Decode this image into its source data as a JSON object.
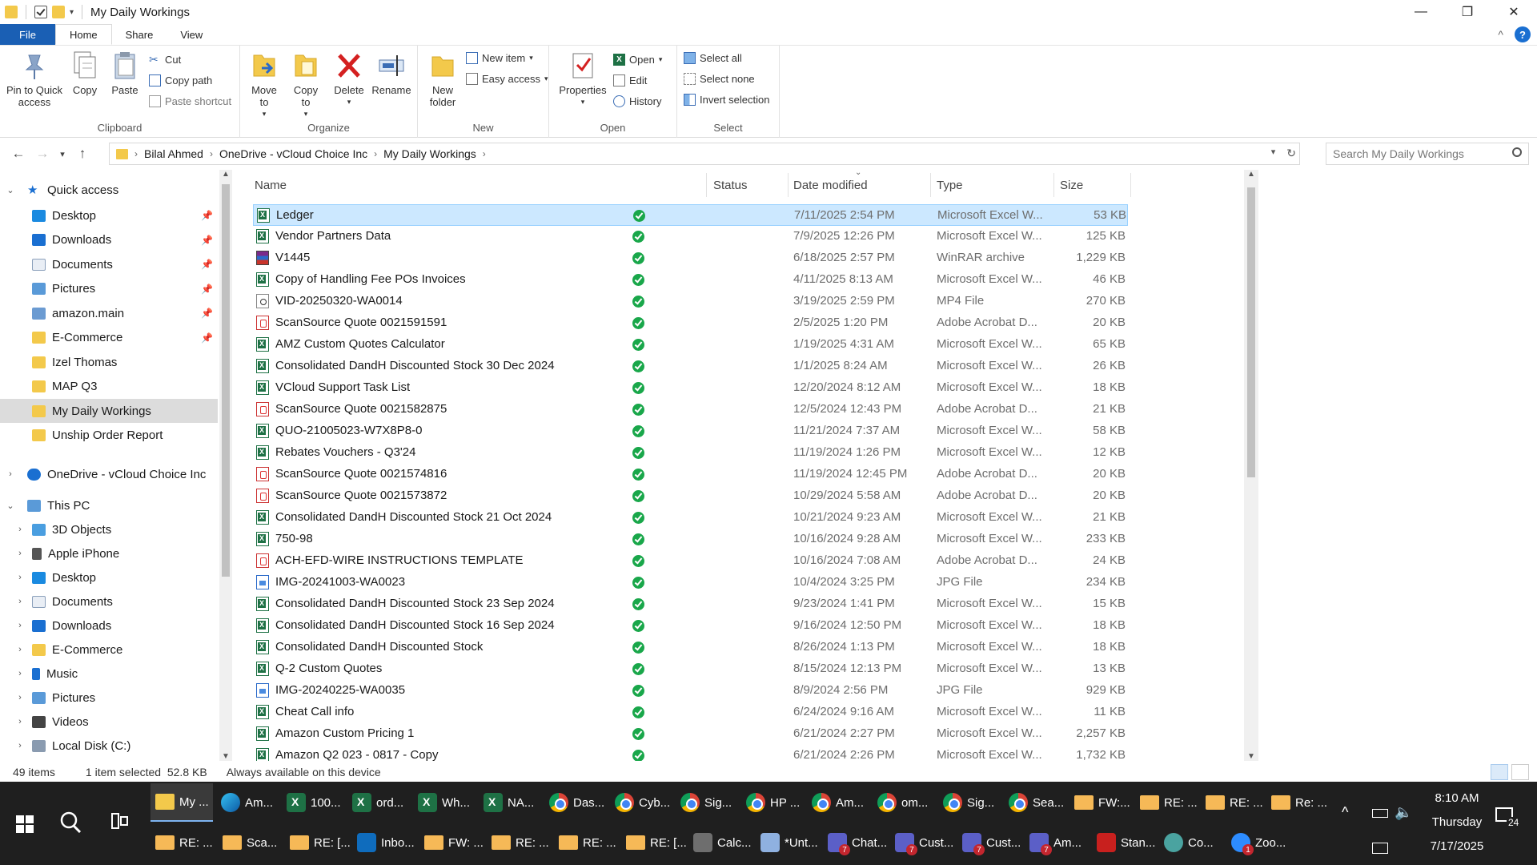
{
  "window": {
    "title": "My Daily Workings",
    "minimize": "—",
    "maximize": "❐",
    "close": "✕"
  },
  "tabs": {
    "file": "File",
    "home": "Home",
    "share": "Share",
    "view": "View",
    "collapse": "^",
    "help": "?"
  },
  "ribbon": {
    "clipboard": {
      "label": "Clipboard",
      "pin": "Pin to Quick access",
      "copy": "Copy",
      "paste": "Paste",
      "cut": "Cut",
      "copy_path": "Copy path",
      "paste_shortcut": "Paste shortcut"
    },
    "organize": {
      "label": "Organize",
      "move_to": "Move to",
      "copy_to": "Copy to",
      "delete": "Delete",
      "rename": "Rename"
    },
    "new": {
      "label": "New",
      "new_folder": "New folder",
      "new_item": "New item",
      "easy_access": "Easy access"
    },
    "open": {
      "label": "Open",
      "properties": "Properties",
      "open": "Open",
      "edit": "Edit",
      "history": "History"
    },
    "select": {
      "label": "Select",
      "select_all": "Select all",
      "select_none": "Select none",
      "invert": "Invert selection"
    }
  },
  "address": {
    "crumbs": [
      "Bilal Ahmed",
      "OneDrive - vCloud Choice Inc",
      "My Daily Workings"
    ],
    "search_placeholder": "Search My Daily Workings"
  },
  "nav": {
    "quick_access": "Quick access",
    "quick_items": [
      "Desktop",
      "Downloads",
      "Documents",
      "Pictures",
      "amazon.main",
      "E-Commerce",
      "Izel Thomas",
      "MAP Q3",
      "My Daily Workings",
      "Unship Order Report"
    ],
    "onedrive": "OneDrive - vCloud Choice Inc",
    "this_pc": "This PC",
    "pc_items": [
      "3D Objects",
      "Apple iPhone",
      "Desktop",
      "Documents",
      "Downloads",
      "E-Commerce",
      "Music",
      "Pictures",
      "Videos",
      "Local Disk (C:)"
    ]
  },
  "columns": {
    "name": "Name",
    "status": "Status",
    "date": "Date modified",
    "type": "Type",
    "size": "Size"
  },
  "files": [
    {
      "name": "Ledger",
      "date": "7/11/2025 2:54 PM",
      "type": "Microsoft Excel W...",
      "size": "53 KB",
      "icon": "excel"
    },
    {
      "name": "Vendor Partners Data",
      "date": "7/9/2025 12:26 PM",
      "type": "Microsoft Excel W...",
      "size": "125 KB",
      "icon": "excel"
    },
    {
      "name": "V1445",
      "date": "6/18/2025 2:57 PM",
      "type": "WinRAR archive",
      "size": "1,229 KB",
      "icon": "rar"
    },
    {
      "name": "Copy of Handling Fee POs Invoices",
      "date": "4/11/2025 8:13 AM",
      "type": "Microsoft Excel W...",
      "size": "46 KB",
      "icon": "excel"
    },
    {
      "name": "VID-20250320-WA0014",
      "date": "3/19/2025 2:59 PM",
      "type": "MP4 File",
      "size": "270 KB",
      "icon": "mp4"
    },
    {
      "name": "ScanSource Quote 0021591591",
      "date": "2/5/2025 1:20 PM",
      "type": "Adobe Acrobat D...",
      "size": "20 KB",
      "icon": "pdf"
    },
    {
      "name": "AMZ Custom Quotes Calculator",
      "date": "1/19/2025 4:31 AM",
      "type": "Microsoft Excel W...",
      "size": "65 KB",
      "icon": "excel"
    },
    {
      "name": "Consolidated DandH Discounted Stock 30 Dec 2024",
      "date": "1/1/2025 8:24 AM",
      "type": "Microsoft Excel W...",
      "size": "26 KB",
      "icon": "excel"
    },
    {
      "name": "VCloud Support Task List",
      "date": "12/20/2024 8:12 AM",
      "type": "Microsoft Excel W...",
      "size": "18 KB",
      "icon": "excel"
    },
    {
      "name": "ScanSource Quote 0021582875",
      "date": "12/5/2024 12:43 PM",
      "type": "Adobe Acrobat D...",
      "size": "21 KB",
      "icon": "pdf"
    },
    {
      "name": "QUO-21005023-W7X8P8-0",
      "date": "11/21/2024 7:37 AM",
      "type": "Microsoft Excel W...",
      "size": "58 KB",
      "icon": "excel"
    },
    {
      "name": "Rebates Vouchers - Q3'24",
      "date": "11/19/2024 1:26 PM",
      "type": "Microsoft Excel W...",
      "size": "12 KB",
      "icon": "excel"
    },
    {
      "name": "ScanSource Quote 0021574816",
      "date": "11/19/2024 12:45 PM",
      "type": "Adobe Acrobat D...",
      "size": "20 KB",
      "icon": "pdf"
    },
    {
      "name": "ScanSource Quote 0021573872",
      "date": "10/29/2024 5:58 AM",
      "type": "Adobe Acrobat D...",
      "size": "20 KB",
      "icon": "pdf"
    },
    {
      "name": "Consolidated DandH Discounted Stock 21 Oct 2024",
      "date": "10/21/2024 9:23 AM",
      "type": "Microsoft Excel W...",
      "size": "21 KB",
      "icon": "excel"
    },
    {
      "name": "750-98",
      "date": "10/16/2024 9:28 AM",
      "type": "Microsoft Excel W...",
      "size": "233 KB",
      "icon": "excel"
    },
    {
      "name": "ACH-EFD-WIRE INSTRUCTIONS TEMPLATE",
      "date": "10/16/2024 7:08 AM",
      "type": "Adobe Acrobat D...",
      "size": "24 KB",
      "icon": "pdf"
    },
    {
      "name": "IMG-20241003-WA0023",
      "date": "10/4/2024 3:25 PM",
      "type": "JPG File",
      "size": "234 KB",
      "icon": "jpg"
    },
    {
      "name": "Consolidated DandH Discounted Stock 23 Sep 2024",
      "date": "9/23/2024 1:41 PM",
      "type": "Microsoft Excel W...",
      "size": "15 KB",
      "icon": "excel"
    },
    {
      "name": "Consolidated DandH Discounted Stock 16 Sep 2024",
      "date": "9/16/2024 12:50 PM",
      "type": "Microsoft Excel W...",
      "size": "18 KB",
      "icon": "excel"
    },
    {
      "name": "Consolidated DandH Discounted Stock",
      "date": "8/26/2024 1:13 PM",
      "type": "Microsoft Excel W...",
      "size": "18 KB",
      "icon": "excel"
    },
    {
      "name": "Q-2 Custom Quotes",
      "date": "8/15/2024 12:13 PM",
      "type": "Microsoft Excel W...",
      "size": "13 KB",
      "icon": "excel"
    },
    {
      "name": "IMG-20240225-WA0035",
      "date": "8/9/2024 2:56 PM",
      "type": "JPG File",
      "size": "929 KB",
      "icon": "jpg"
    },
    {
      "name": "Cheat Call info",
      "date": "6/24/2024 9:16 AM",
      "type": "Microsoft Excel W...",
      "size": "11 KB",
      "icon": "excel"
    },
    {
      "name": "Amazon Custom Pricing 1",
      "date": "6/21/2024 2:27 PM",
      "type": "Microsoft Excel W...",
      "size": "2,257 KB",
      "icon": "excel"
    },
    {
      "name": "Amazon Q2 023 - 0817 - Copy",
      "date": "6/21/2024 2:26 PM",
      "type": "Microsoft Excel W...",
      "size": "1,732 KB",
      "icon": "excel"
    }
  ],
  "statusbar": {
    "count": "49 items",
    "selected": "1 item selected  52.8 KB",
    "availability": "Always available on this device"
  },
  "taskbar": {
    "row1": [
      {
        "label": "My ...",
        "icon": "folder",
        "active": true
      },
      {
        "label": "Am...",
        "icon": "edge"
      },
      {
        "label": "100...",
        "icon": "excel"
      },
      {
        "label": "ord...",
        "icon": "excel"
      },
      {
        "label": "Wh...",
        "icon": "excel"
      },
      {
        "label": "NA...",
        "icon": "excel"
      },
      {
        "label": "Das...",
        "icon": "chrome"
      },
      {
        "label": "Cyb...",
        "icon": "chrome"
      },
      {
        "label": "Sig...",
        "icon": "chrome"
      },
      {
        "label": "HP ...",
        "icon": "chrome"
      },
      {
        "label": "Am...",
        "icon": "chrome"
      },
      {
        "label": "om...",
        "icon": "chrome"
      },
      {
        "label": "Sig...",
        "icon": "chrome"
      },
      {
        "label": "Sea...",
        "icon": "chrome"
      },
      {
        "label": "FW:...",
        "icon": "mail"
      },
      {
        "label": "RE: ...",
        "icon": "mail"
      },
      {
        "label": "RE: ...",
        "icon": "mail"
      },
      {
        "label": "Re: ...",
        "icon": "mail"
      }
    ],
    "row2": [
      {
        "label": "RE: ...",
        "icon": "mail"
      },
      {
        "label": "Sca...",
        "icon": "mail"
      },
      {
        "label": "RE: [...",
        "icon": "mail"
      },
      {
        "label": "Inbo...",
        "icon": "outlook"
      },
      {
        "label": "FW: ...",
        "icon": "mail"
      },
      {
        "label": "RE: ...",
        "icon": "mail"
      },
      {
        "label": "RE: ...",
        "icon": "mail"
      },
      {
        "label": "RE: [...",
        "icon": "mail"
      },
      {
        "label": "Calc...",
        "icon": "calc"
      },
      {
        "label": "*Unt...",
        "icon": "note"
      },
      {
        "label": "Chat...",
        "icon": "teams",
        "badge": "7"
      },
      {
        "label": "Cust...",
        "icon": "teams",
        "badge": "7"
      },
      {
        "label": "Cust...",
        "icon": "teams",
        "badge": "7"
      },
      {
        "label": "Am...",
        "icon": "teams",
        "badge": "7"
      },
      {
        "label": "Stan...",
        "icon": "pdf"
      },
      {
        "label": "Co...",
        "icon": "co"
      },
      {
        "label": "Zoo...",
        "icon": "zoom",
        "badge": "1"
      }
    ],
    "time": "8:10 AM",
    "day": "Thursday",
    "date": "7/17/2025",
    "notifications": "24"
  }
}
